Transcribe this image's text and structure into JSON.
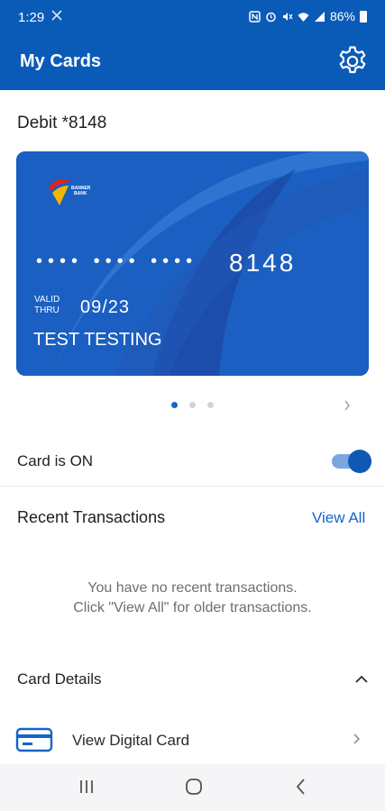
{
  "status_bar": {
    "time": "1:29",
    "battery": "86%",
    "icons": [
      "nfc-icon",
      "alarm-icon",
      "mute-icon",
      "wifi-icon",
      "signal-icon",
      "battery-icon"
    ]
  },
  "app_bar": {
    "title": "My Cards",
    "settings_icon": "gear-icon",
    "background": "#0a5bb8"
  },
  "card_section": {
    "heading": "Debit *8148",
    "card": {
      "brand_logo": "bank-logo",
      "masked_groups": "•••• •••• ••••",
      "last4": "8148",
      "valid_label_line1": "VALID",
      "valid_label_line2": "THRU",
      "expiry": "09/23",
      "holder": "TEST TESTING",
      "color": "#1a5fc1"
    },
    "pager": {
      "count": 3,
      "active_index": 0,
      "next_icon": "chevron-right-icon"
    }
  },
  "card_status": {
    "label": "Card is ON",
    "toggle_on": true
  },
  "recent_transactions": {
    "title": "Recent Transactions",
    "view_all": "View All",
    "empty_line1": "You have no recent transactions.",
    "empty_line2": "Click \"View All\" for older transactions."
  },
  "card_details": {
    "title": "Card Details",
    "expanded": true,
    "items": [
      {
        "label": "View Digital Card",
        "icon": "credit-card-icon"
      }
    ]
  },
  "system_nav": {
    "buttons": [
      "recent-apps-icon",
      "home-icon",
      "back-icon"
    ]
  },
  "colors": {
    "accent": "#1565c8",
    "muted_text": "#6b6f75"
  }
}
